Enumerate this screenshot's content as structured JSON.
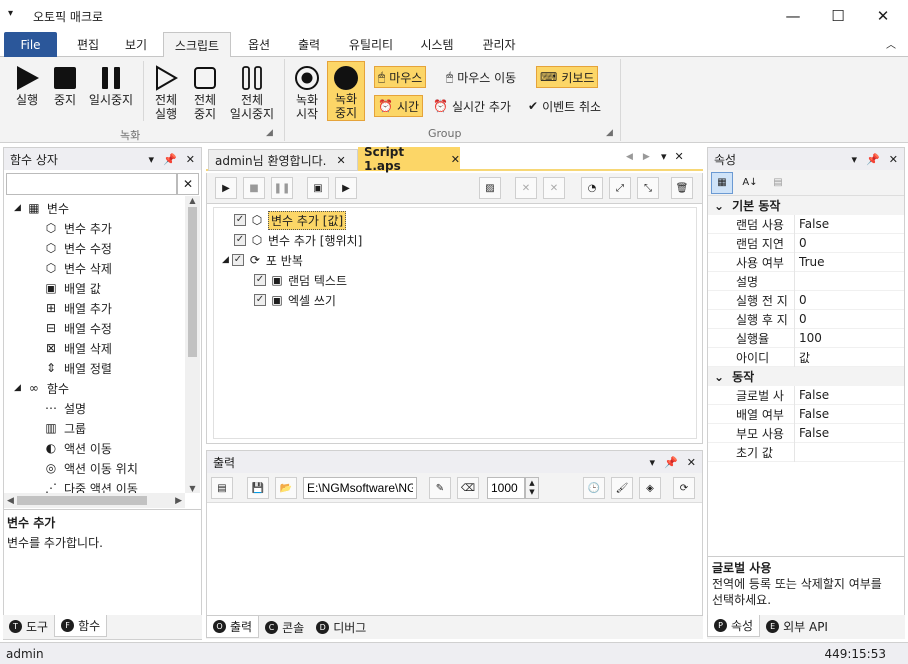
{
  "window": {
    "title": "오토픽 매크로",
    "menu_icon": "down-arrow",
    "minimize": "—",
    "maximize": "☐",
    "close": "✕"
  },
  "menu_tabs": [
    {
      "label": "File"
    },
    {
      "label": "편집"
    },
    {
      "label": "보기"
    },
    {
      "label": "스크립트"
    },
    {
      "label": "옵션"
    },
    {
      "label": "출력"
    },
    {
      "label": "유틸리티"
    },
    {
      "label": "시스템"
    },
    {
      "label": "관리자"
    }
  ],
  "ribbon": {
    "record": {
      "run": "실행",
      "stop": "중지",
      "pause": "일시중지",
      "run_all": [
        "전체",
        "실행"
      ],
      "stop_all": [
        "전체",
        "중지"
      ],
      "pause_all": [
        "전체",
        "일시중지"
      ],
      "group": "녹화"
    },
    "group2": {
      "rec_start": [
        "녹화",
        "시작"
      ],
      "rec_stop": [
        "녹화",
        "중지"
      ],
      "mouse": "마우스",
      "mouse_move": "마우스 이동",
      "keyboard": "키보드",
      "time": "시간",
      "realtime_add": "실시간 추가",
      "event_cancel": "이벤트 취소",
      "group": "Group"
    }
  },
  "left_panel": {
    "title": "함수 상자",
    "search_value": "",
    "tree": [
      {
        "label": "변수",
        "level": 0,
        "icon": "grid-icon"
      },
      {
        "label": "변수 추가",
        "level": 1,
        "icon": "cube-icon"
      },
      {
        "label": "변수 수정",
        "level": 1,
        "icon": "cube-icon"
      },
      {
        "label": "변수 삭제",
        "level": 1,
        "icon": "cube-icon"
      },
      {
        "label": "배열 값",
        "level": 1,
        "icon": "array-icon"
      },
      {
        "label": "배열 추가",
        "level": 1,
        "icon": "array-add-icon"
      },
      {
        "label": "배열 수정",
        "level": 1,
        "icon": "array-edit-icon"
      },
      {
        "label": "배열 삭제",
        "level": 1,
        "icon": "array-delete-icon"
      },
      {
        "label": "배열 정렬",
        "level": 1,
        "icon": "sort-icon"
      },
      {
        "label": "함수",
        "level": 0,
        "icon": "infinity-icon"
      },
      {
        "label": "설명",
        "level": 1,
        "icon": "dots-icon"
      },
      {
        "label": "그룹",
        "level": 1,
        "icon": "group-icon"
      },
      {
        "label": "액션 이동",
        "level": 1,
        "icon": "pacman-icon"
      },
      {
        "label": "액션 이동 위치",
        "level": 1,
        "icon": "target-icon"
      },
      {
        "label": "다중 액션 이동",
        "level": 1,
        "icon": "multi-icon"
      }
    ],
    "info_title": "변수 추가",
    "info_desc": "변수를 추가합니다.",
    "tabs": [
      {
        "letter": "T",
        "label": "도구"
      },
      {
        "letter": "F",
        "label": "함수"
      }
    ]
  },
  "doc_tabs": [
    {
      "label": "admin님 환영합니다."
    },
    {
      "label": "Script 1.aps"
    }
  ],
  "script_tree": [
    {
      "label": "변수 추가 [값]",
      "level": 0,
      "checked": true,
      "selected": true
    },
    {
      "label": "변수 추가 [행위치]",
      "level": 0,
      "checked": true
    },
    {
      "label": "포 반복",
      "level": 0,
      "checked": true
    },
    {
      "label": "랜덤 텍스트",
      "level": 1,
      "checked": true
    },
    {
      "label": "엑셀 쓰기",
      "level": 1,
      "checked": true
    }
  ],
  "output": {
    "title": "출력",
    "path": "E:\\NGMsoftware\\NG",
    "count": "1000",
    "tabs": [
      {
        "letter": "O",
        "label": "출력"
      },
      {
        "letter": "C",
        "label": "콘솔"
      },
      {
        "letter": "D",
        "label": "디버그"
      }
    ]
  },
  "properties": {
    "title": "속성",
    "sections": [
      {
        "name": "기본 동작",
        "rows": [
          {
            "key": "랜덤 사용",
            "value": "False"
          },
          {
            "key": "랜덤 지연",
            "value": "0"
          },
          {
            "key": "사용 여부",
            "value": "True"
          },
          {
            "key": "설명",
            "value": ""
          },
          {
            "key": "실행 전 지",
            "value": "0"
          },
          {
            "key": "실행 후 지",
            "value": "0"
          },
          {
            "key": "실행율",
            "value": "100"
          },
          {
            "key": "아이디",
            "value": "값"
          }
        ]
      },
      {
        "name": "동작",
        "rows": [
          {
            "key": "글로벌 사",
            "value": "False"
          },
          {
            "key": "배열 여부",
            "value": "False"
          },
          {
            "key": "부모 사용",
            "value": "False"
          },
          {
            "key": "초기 값",
            "value": ""
          }
        ]
      }
    ],
    "info_title": "글로벌 사용",
    "info_desc_1": "전역에 등록 또는 삭제할지 여부를",
    "info_desc_2": "선택하세요.",
    "tabs": [
      {
        "letter": "P",
        "label": "속성"
      },
      {
        "letter": "E",
        "label": "외부 API"
      }
    ]
  },
  "status": {
    "user": "admin",
    "time": "449:15:53"
  },
  "colors": {
    "accent": "#2b579a",
    "highlight": "#fcd667"
  }
}
